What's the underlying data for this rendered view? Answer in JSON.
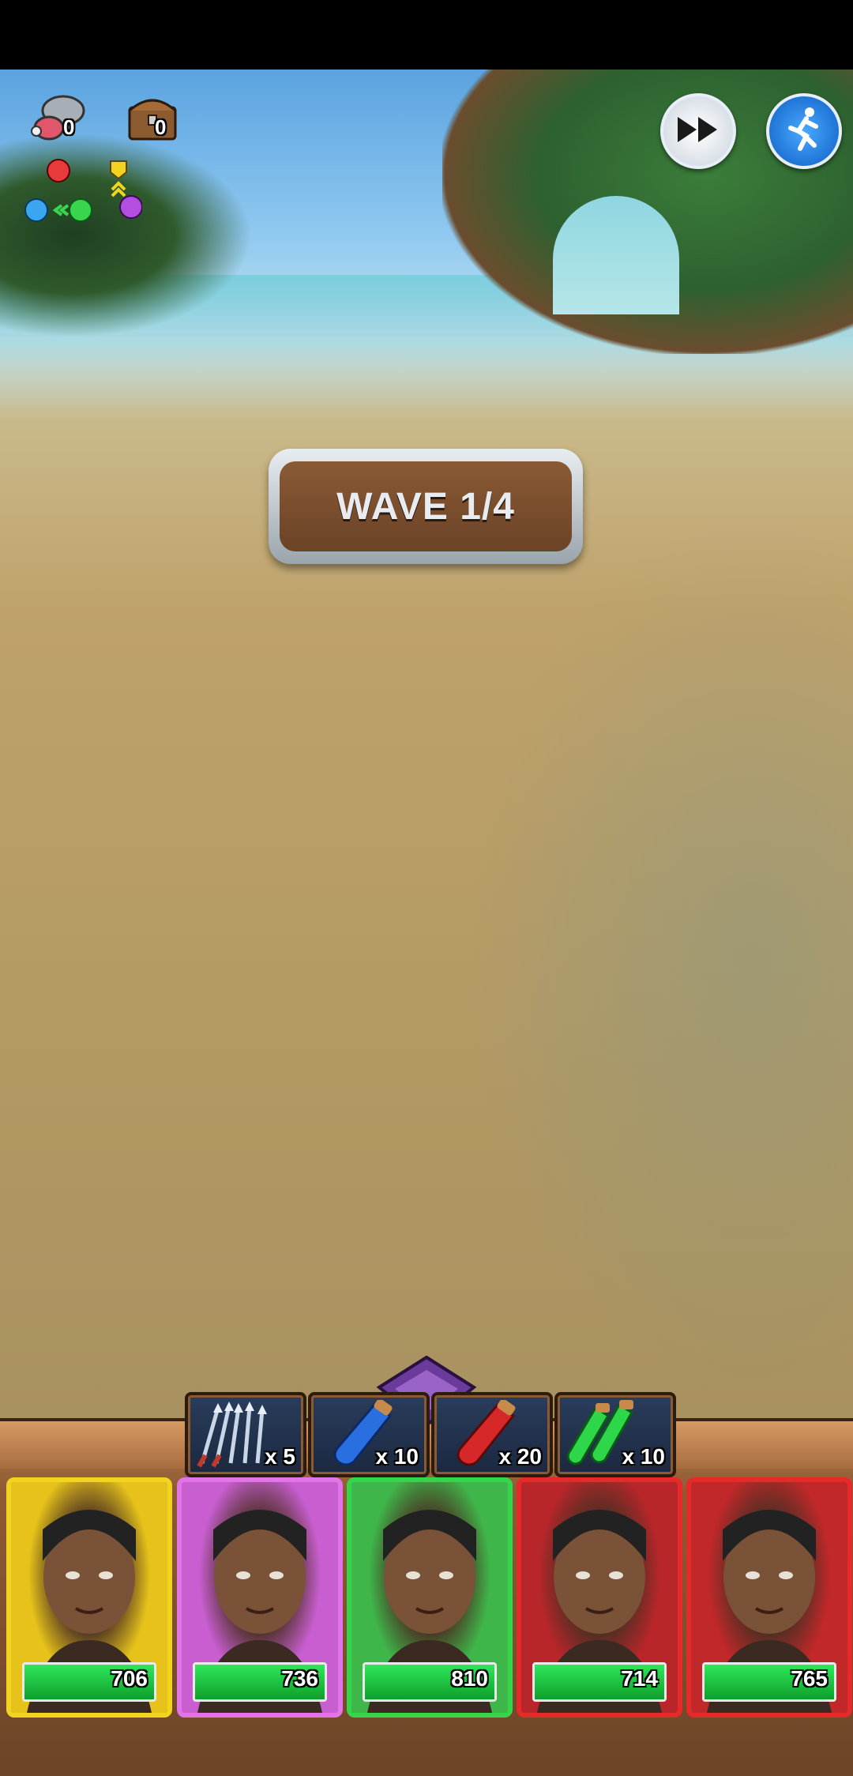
{
  "hud": {
    "meat_count": "0",
    "chest_count": "0",
    "fast_forward_icon": "fast-forward-icon",
    "auto_battle_icon": "running-man-icon"
  },
  "wave": {
    "label": "WAVE 1/4"
  },
  "items": [
    {
      "name": "arrows",
      "icon": "arrows-icon",
      "count": "x 5"
    },
    {
      "name": "blue-potion",
      "icon": "blue-potion-icon",
      "count": "x 10"
    },
    {
      "name": "red-potion",
      "icon": "red-potion-icon",
      "count": "x 20"
    },
    {
      "name": "green-potions",
      "icon": "green-potions-icon",
      "count": "x 10"
    }
  ],
  "heroes": [
    {
      "hp": "706",
      "hp_fraction": 1.0,
      "border_color": "#f2d320",
      "bg": "#e6c21a"
    },
    {
      "hp": "736",
      "hp_fraction": 1.0,
      "border_color": "#e374e8",
      "bg": "#c85ed0"
    },
    {
      "hp": "810",
      "hp_fraction": 1.0,
      "border_color": "#33d64a",
      "bg": "#3fb64a"
    },
    {
      "hp": "714",
      "hp_fraction": 1.0,
      "border_color": "#e62a2a",
      "bg": "#b8262a"
    },
    {
      "hp": "765",
      "hp_fraction": 1.0,
      "border_color": "#e62a2a",
      "bg": "#c0282a"
    }
  ]
}
